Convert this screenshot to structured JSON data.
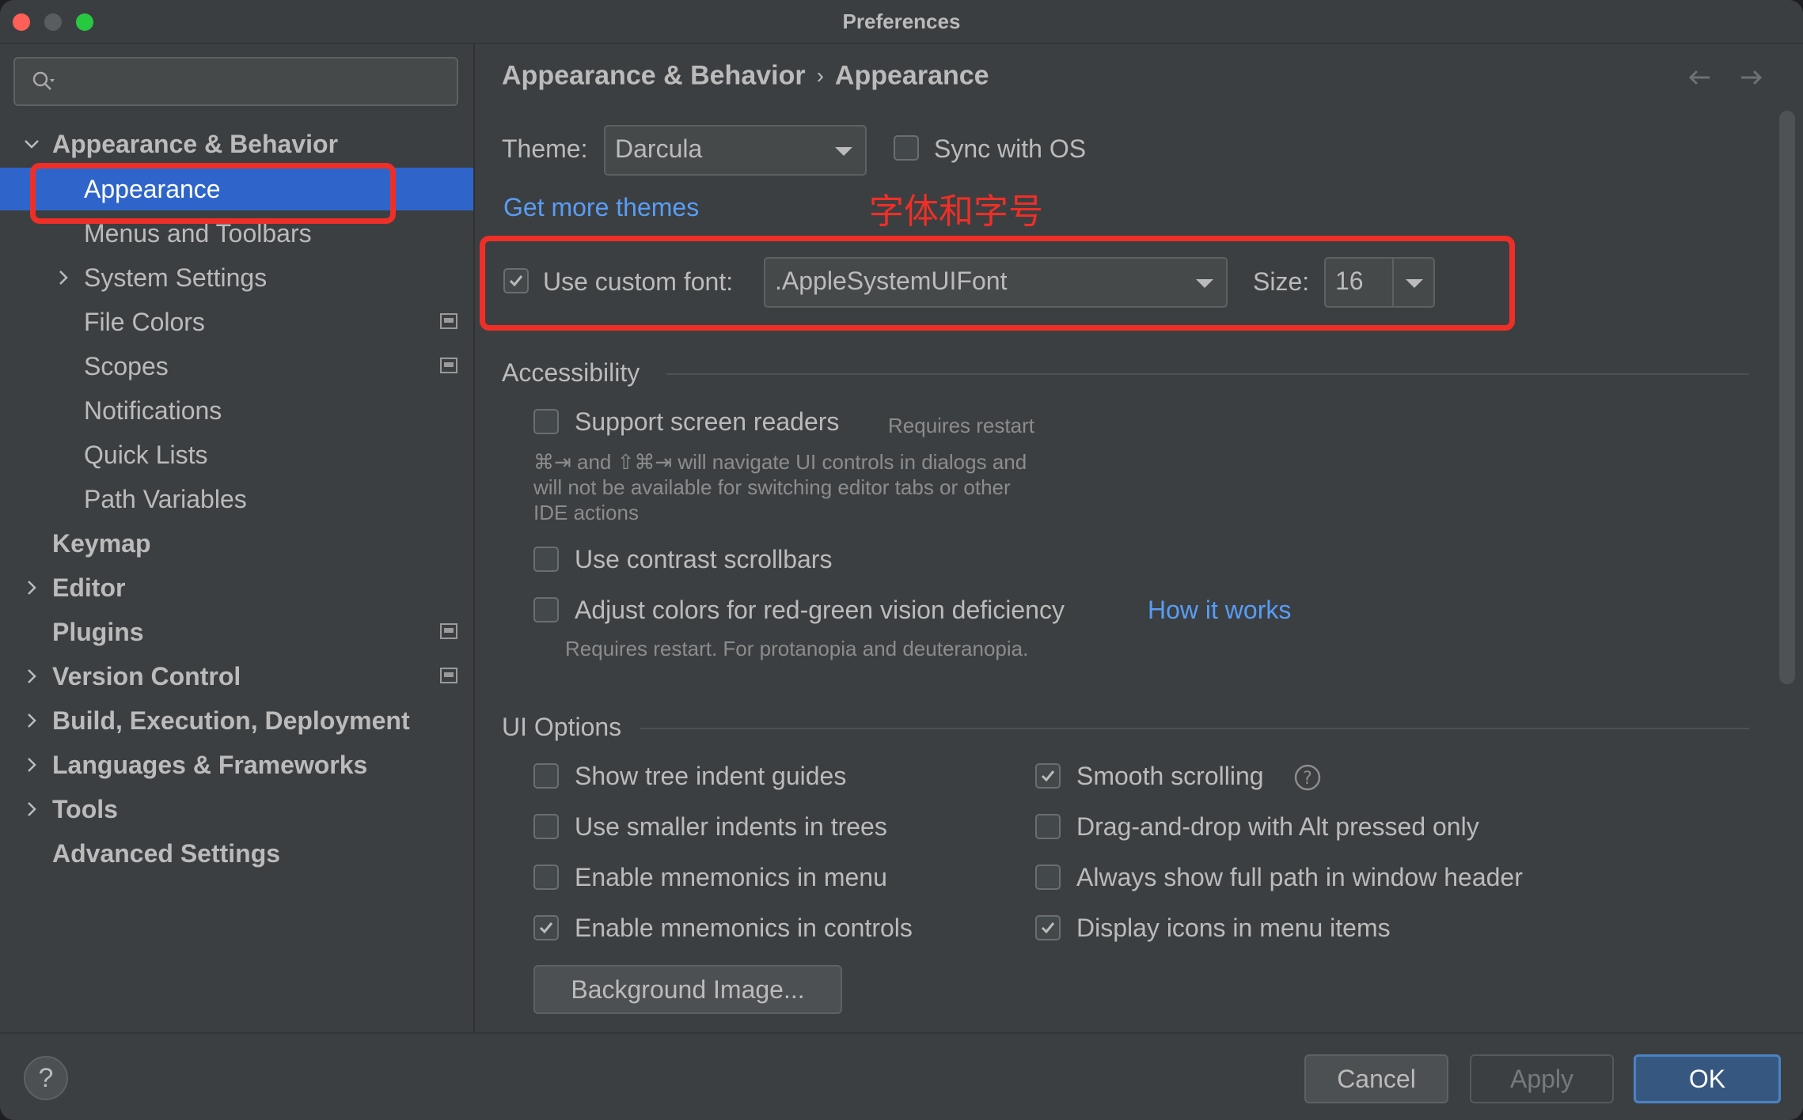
{
  "window": {
    "title": "Preferences"
  },
  "sidebar": {
    "search": {
      "placeholder": ""
    },
    "items": [
      {
        "label": "Appearance & Behavior",
        "bold": true,
        "expanded": true
      },
      {
        "label": "Appearance",
        "selected": true
      },
      {
        "label": "Menus and Toolbars"
      },
      {
        "label": "System Settings"
      },
      {
        "label": "File Colors"
      },
      {
        "label": "Scopes"
      },
      {
        "label": "Notifications"
      },
      {
        "label": "Quick Lists"
      },
      {
        "label": "Path Variables"
      },
      {
        "label": "Keymap",
        "bold": true
      },
      {
        "label": "Editor",
        "bold": true
      },
      {
        "label": "Plugins",
        "bold": true
      },
      {
        "label": "Version Control",
        "bold": true
      },
      {
        "label": "Build, Execution, Deployment",
        "bold": true
      },
      {
        "label": "Languages & Frameworks",
        "bold": true
      },
      {
        "label": "Tools",
        "bold": true
      },
      {
        "label": "Advanced Settings",
        "bold": true
      }
    ]
  },
  "breadcrumb": {
    "parent": "Appearance & Behavior",
    "separator": "›",
    "current": "Appearance"
  },
  "theme": {
    "label": "Theme:",
    "value": "Darcula",
    "sync_label": "Sync with OS",
    "sync_checked": false,
    "more_link": "Get more themes"
  },
  "annotation": {
    "text": "字体和字号",
    "color": "#ef2f27"
  },
  "font": {
    "checkbox_label": "Use custom font:",
    "checked": true,
    "value": ".AppleSystemUIFont",
    "size_label": "Size:",
    "size_value": "16"
  },
  "accessibility": {
    "title": "Accessibility",
    "screen_readers": {
      "label": "Support screen readers",
      "checked": false,
      "note": "Requires restart",
      "hint_lines": [
        "⌘⇥ and ⇧⌘⇥ will navigate UI controls in dialogs and",
        "will not be available for switching editor tabs or other",
        "IDE actions"
      ]
    },
    "contrast_scrollbars": {
      "label": "Use contrast scrollbars",
      "checked": false
    },
    "color_deficiency": {
      "label": "Adjust colors for red-green vision deficiency",
      "checked": false,
      "link": "How it works",
      "hint": "Requires restart. For protanopia and deuteranopia."
    }
  },
  "ui_options": {
    "title": "UI Options",
    "left": [
      {
        "label": "Show tree indent guides",
        "checked": false
      },
      {
        "label": "Use smaller indents in trees",
        "checked": false
      },
      {
        "label": "Enable mnemonics in menu",
        "checked": false
      },
      {
        "label": "Enable mnemonics in controls",
        "checked": true
      }
    ],
    "right": [
      {
        "label": "Smooth scrolling",
        "checked": true
      },
      {
        "label": "Drag-and-drop with Alt pressed only",
        "checked": false
      },
      {
        "label": "Always show full path in window header",
        "checked": false
      },
      {
        "label": "Display icons in menu items",
        "checked": true
      }
    ],
    "background_button": "Background Image..."
  },
  "footer": {
    "help": "?",
    "cancel": "Cancel",
    "apply": "Apply",
    "ok": "OK"
  },
  "colors": {
    "accent": "#2f65ca",
    "link": "#589df6",
    "annotation": "#ef2f27",
    "ok_button": "#365880"
  }
}
